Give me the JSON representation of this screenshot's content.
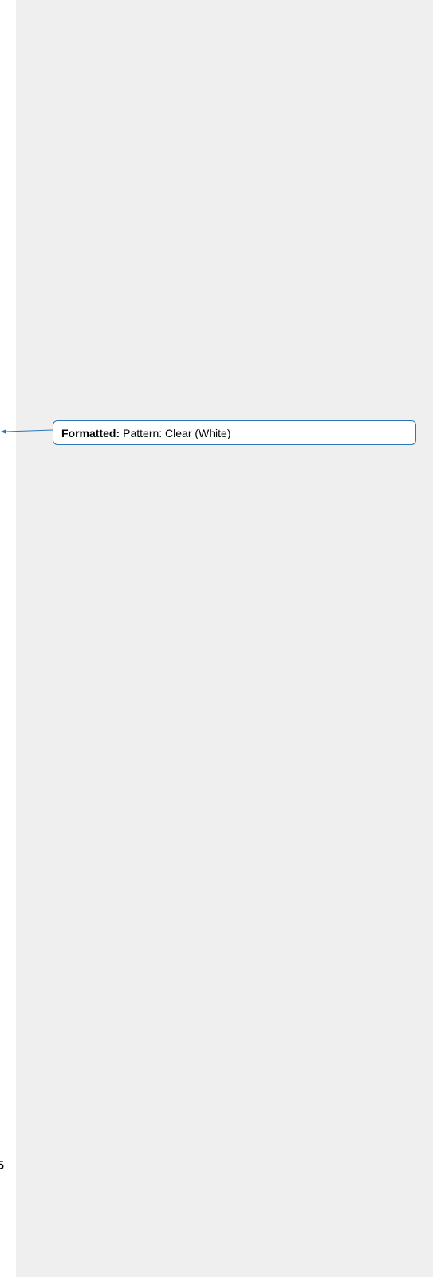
{
  "document": {
    "page_number_fragment": "5"
  },
  "markup": {
    "balloon_label": "Formatted:",
    "balloon_text": "Pattern: Clear (White)",
    "connector_color": "#2e75b6",
    "pane_color": "#efefef"
  }
}
